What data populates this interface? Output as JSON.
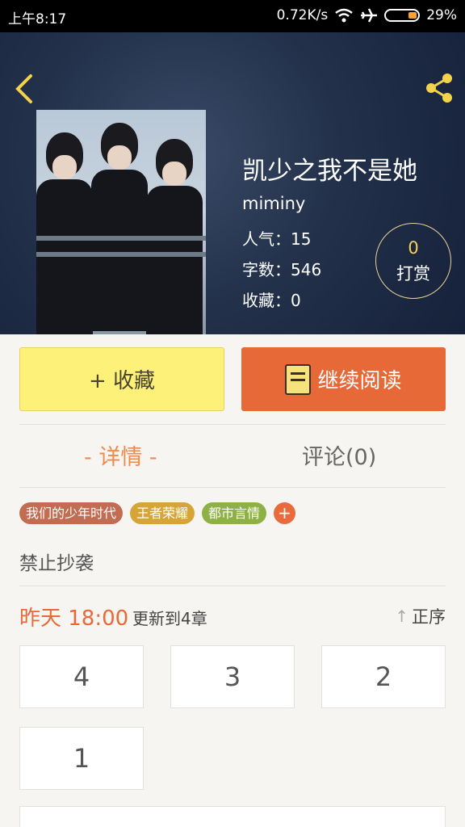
{
  "status_bar": {
    "time": "上午8:17",
    "network_speed": "0.72K/s",
    "battery": "29%",
    "icons": [
      "wifi-icon",
      "airplane-icon",
      "battery-icon"
    ]
  },
  "book": {
    "title": "凯少之我不是她",
    "author": "miminy",
    "popularity_label": "人气：15",
    "word_count_label": "字数：546",
    "favorites_label": "收藏：0"
  },
  "reward": {
    "count": "0",
    "label": "打赏"
  },
  "actions": {
    "favorite_label": "+ 收藏",
    "continue_label": "继续阅读"
  },
  "tabs": {
    "detail": "- 详情 -",
    "comments": "评论(0)"
  },
  "tags": [
    {
      "label": "我们的少年时代",
      "color": "#c26c52"
    },
    {
      "label": "王者荣耀",
      "color": "#d6a437"
    },
    {
      "label": "都市言情",
      "color": "#8db145"
    }
  ],
  "tag_add": "+",
  "notice": "禁止抄袭",
  "update": {
    "time": "昨天 18:00",
    "text": "更新到4章",
    "sort_label": "正序"
  },
  "chapters": [
    "4",
    "3",
    "2",
    "1"
  ],
  "colors": {
    "accent": "#e86938",
    "favorite_button": "#fdf17a",
    "header_bg": "#23314b"
  }
}
